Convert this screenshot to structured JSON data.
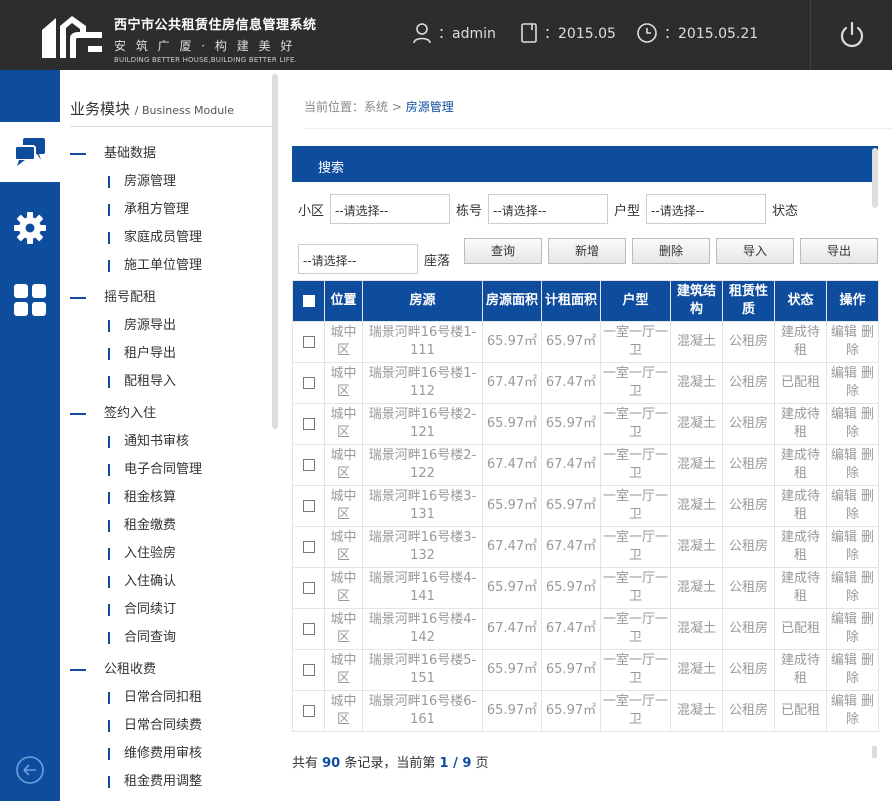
{
  "header": {
    "title": "西宁市公共租赁住房信息管理系统",
    "slogan": "安 筑 广 厦 · 构 建 美 好",
    "slogan_en": "BUILDING BETTER HOUSE,BUILDING BETTER LIFE.",
    "user_label": "：admin",
    "month_label": "：2015.05",
    "date_label": "：2015.05.21"
  },
  "sidebar": {
    "title": "业务模块",
    "title_en": "/ Business Module",
    "groups": [
      {
        "label": "基础数据",
        "items": [
          "房源管理",
          "承租方管理",
          "家庭成员管理",
          "施工单位管理"
        ]
      },
      {
        "label": "摇号配租",
        "items": [
          "房源导出",
          "租户导出",
          "配租导入"
        ]
      },
      {
        "label": "签约入住",
        "items": [
          "通知书审核",
          "电子合同管理",
          "租金核算",
          "租金缴费",
          "入住验房",
          "入住确认",
          "合同续订",
          "合同查询"
        ]
      },
      {
        "label": "公租收费",
        "items": [
          "日常合同扣租",
          "日常合同续费",
          "维修费用审核",
          "租金费用调整"
        ]
      }
    ]
  },
  "breadcrumb": {
    "prefix": "当前位置：系统 > ",
    "current": "房源管理"
  },
  "search": {
    "header": "搜索",
    "fields": {
      "community_label": "小区",
      "community_value": "--请选择--",
      "building_label": "栋号",
      "building_value": "--请选择--",
      "type_label": "户型",
      "type_value": "--请选择--",
      "status_label": "状态",
      "status_value": "--请选择--",
      "seat_label": "座落"
    },
    "buttons": {
      "query": "查询",
      "add": "新增",
      "delete": "删除",
      "import": "导入",
      "export": "导出"
    }
  },
  "table": {
    "headers": [
      "位置",
      "房源",
      "房源面积",
      "计租面积",
      "户型",
      "建筑结构",
      "租赁性质",
      "状态",
      "操作"
    ],
    "rows": [
      {
        "loc": "城中区",
        "house": "瑞景河畔16号楼1-111",
        "area": "65.97㎡",
        "rent_area": "65.97㎡",
        "type": "一室一厅一卫",
        "struct": "混凝土",
        "nature": "公租房",
        "status": "建成待租",
        "ops": "编辑 删除"
      },
      {
        "loc": "城中区",
        "house": "瑞景河畔16号楼1-112",
        "area": "67.47㎡",
        "rent_area": "67.47㎡",
        "type": "一室一厅一卫",
        "struct": "混凝土",
        "nature": "公租房",
        "status": "已配租",
        "ops": "编辑 删除"
      },
      {
        "loc": "城中区",
        "house": "瑞景河畔16号楼2-121",
        "area": "65.97㎡",
        "rent_area": "65.97㎡",
        "type": "一室一厅一卫",
        "struct": "混凝土",
        "nature": "公租房",
        "status": "建成待租",
        "ops": "编辑 删除"
      },
      {
        "loc": "城中区",
        "house": "瑞景河畔16号楼2-122",
        "area": "67.47㎡",
        "rent_area": "67.47㎡",
        "type": "一室一厅一卫",
        "struct": "混凝土",
        "nature": "公租房",
        "status": "建成待租",
        "ops": "编辑 删除"
      },
      {
        "loc": "城中区",
        "house": "瑞景河畔16号楼3-131",
        "area": "65.97㎡",
        "rent_area": "65.97㎡",
        "type": "一室一厅一卫",
        "struct": "混凝土",
        "nature": "公租房",
        "status": "建成待租",
        "ops": "编辑 删除"
      },
      {
        "loc": "城中区",
        "house": "瑞景河畔16号楼3-132",
        "area": "67.47㎡",
        "rent_area": "67.47㎡",
        "type": "一室一厅一卫",
        "struct": "混凝土",
        "nature": "公租房",
        "status": "建成待租",
        "ops": "编辑 删除"
      },
      {
        "loc": "城中区",
        "house": "瑞景河畔16号楼4-141",
        "area": "65.97㎡",
        "rent_area": "65.97㎡",
        "type": "一室一厅一卫",
        "struct": "混凝土",
        "nature": "公租房",
        "status": "建成待租",
        "ops": "编辑 删除"
      },
      {
        "loc": "城中区",
        "house": "瑞景河畔16号楼4-142",
        "area": "67.47㎡",
        "rent_area": "67.47㎡",
        "type": "一室一厅一卫",
        "struct": "混凝土",
        "nature": "公租房",
        "status": "已配租",
        "ops": "编辑 删除"
      },
      {
        "loc": "城中区",
        "house": "瑞景河畔16号楼5-151",
        "area": "65.97㎡",
        "rent_area": "65.97㎡",
        "type": "一室一厅一卫",
        "struct": "混凝土",
        "nature": "公租房",
        "status": "建成待租",
        "ops": "编辑 删除"
      },
      {
        "loc": "城中区",
        "house": "瑞景河畔16号楼6-161",
        "area": "65.97㎡",
        "rent_area": "65.97㎡",
        "type": "一室一厅一卫",
        "struct": "混凝土",
        "nature": "公租房",
        "status": "已配租",
        "ops": "编辑 删除"
      }
    ]
  },
  "pagination": {
    "prefix": "共有 ",
    "total": "90",
    "middle": " 条记录，当前第 ",
    "page": "1 / 9",
    "suffix": " 页"
  },
  "colors": {
    "brand_blue": "#0e4d9e",
    "header_bg": "#2d2d2d"
  }
}
